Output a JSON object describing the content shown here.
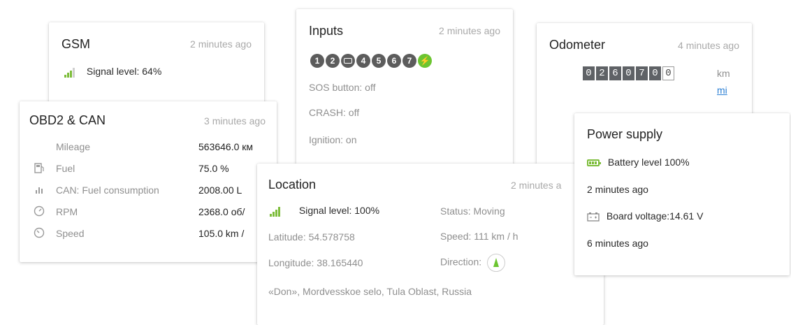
{
  "gsm": {
    "title": "GSM",
    "ago": "2 minutes ago",
    "signal": "Signal level: 64%"
  },
  "inputs": {
    "title": "Inputs",
    "ago": "2 minutes ago",
    "circles": [
      "1",
      "2",
      "",
      "4",
      "5",
      "6",
      "7",
      ""
    ],
    "sos": "SOS button: off",
    "crash": "CRASH: off",
    "ignition": "Ignition: on"
  },
  "odometer": {
    "title": "Odometer",
    "ago": "4 minutes ago",
    "digits": [
      "0",
      "2",
      "6",
      "0",
      "7",
      "0",
      "0"
    ],
    "unit_km": "km",
    "unit_mi": "mi"
  },
  "obd": {
    "title": "OBD2 & CAN",
    "ago": "3 minutes ago",
    "rows": [
      {
        "label": "Mileage",
        "value": "563646.0 км"
      },
      {
        "label": "Fuel",
        "value": "75.0 %"
      },
      {
        "label": "CAN: Fuel consumption",
        "value": "2008.00 L"
      },
      {
        "label": "RPM",
        "value": "2368.0 об/"
      },
      {
        "label": "Speed",
        "value": "105.0 km /"
      }
    ]
  },
  "location": {
    "title": "Location",
    "ago": "2 minutes a",
    "signal": "Signal level: 100%",
    "status": "Status: Moving",
    "latitude": "Latitude: 54.578758",
    "speed": "Speed: 111 km / h",
    "longitude": "Longitude: 38.165440",
    "direction": "Direction:",
    "address": "«Don», Mordvesskoe selo, Tula Oblast, Russia"
  },
  "power": {
    "title": "Power supply",
    "battery": "Battery level 100%",
    "ago1": "2 minutes ago",
    "voltage": "Board voltage:14.61 V",
    "ago2": "6 minutes ago"
  },
  "colors": {
    "accent_green": "#6cc531",
    "link": "#2a7fd4"
  }
}
